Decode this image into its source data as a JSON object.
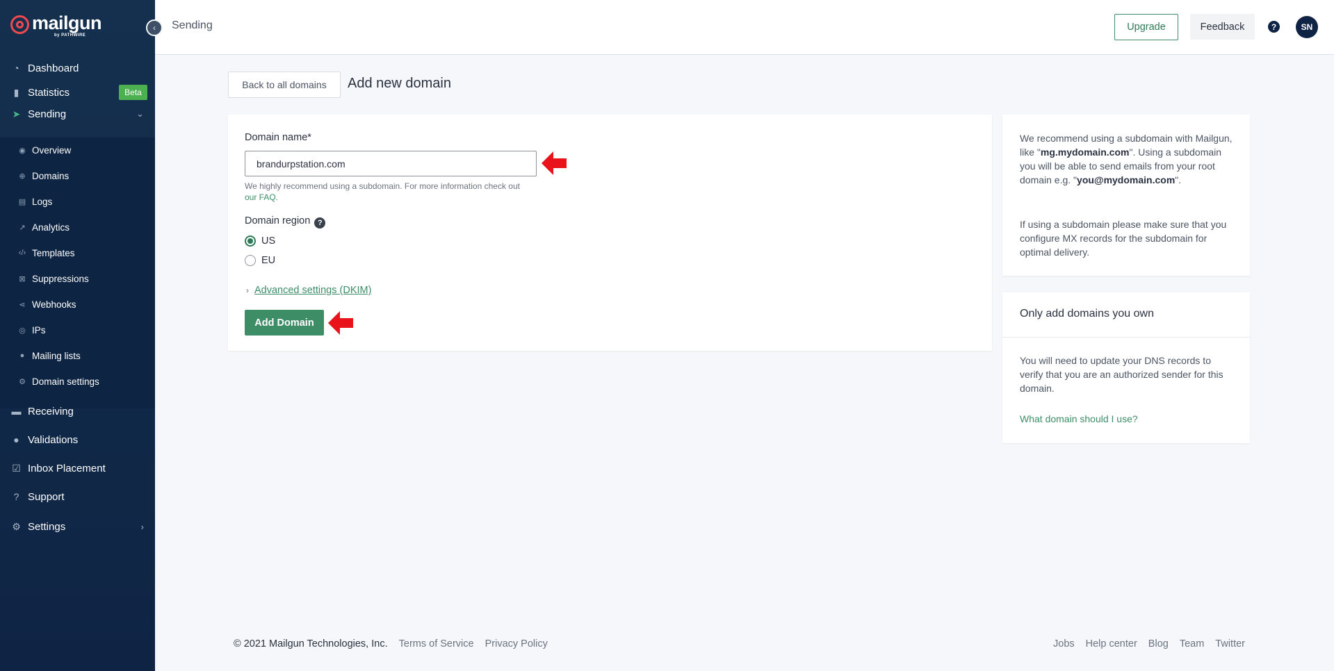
{
  "brand": {
    "name": "mailgun",
    "byline": "by PATHWIRE"
  },
  "topbar": {
    "section": "Sending",
    "upgrade": "Upgrade",
    "feedback": "Feedback",
    "help": "?",
    "avatar": "SN"
  },
  "nav": {
    "dashboard": "Dashboard",
    "statistics": "Statistics",
    "beta": "Beta",
    "sending": "Sending",
    "sub": {
      "overview": "Overview",
      "domains": "Domains",
      "logs": "Logs",
      "analytics": "Analytics",
      "templates": "Templates",
      "suppressions": "Suppressions",
      "webhooks": "Webhooks",
      "ips": "IPs",
      "mailing_lists": "Mailing lists",
      "domain_settings": "Domain settings"
    },
    "receiving": "Receiving",
    "validations": "Validations",
    "inbox_placement": "Inbox Placement",
    "support": "Support",
    "settings": "Settings"
  },
  "page": {
    "back": "Back to all domains",
    "title": "Add new domain"
  },
  "form": {
    "domain_label": "Domain name*",
    "domain_value": "brandurpstation.com",
    "hint_text": "We highly recommend using a subdomain. For more information check out",
    "hint_link": "our FAQ.",
    "region_label": "Domain region",
    "region_help": "?",
    "region_us": "US",
    "region_eu": "EU",
    "advanced": "Advanced settings (DKIM)",
    "submit": "Add Domain"
  },
  "info1": {
    "p1_a": "We recommend using a subdomain with Mailgun, like \"",
    "p1_b": "mg.mydomain.com",
    "p1_c": "\". Using a subdomain you will be able to send emails from your root domain e.g. \"",
    "p1_d": "you@mydomain.com",
    "p1_e": "\".",
    "p2": "If using a subdomain please make sure that you configure MX records for the subdomain for optimal delivery."
  },
  "info2": {
    "title": "Only add domains you own",
    "text": "You will need to update your DNS records to verify that you are an authorized sender for this domain.",
    "link": "What domain should I use?"
  },
  "footer": {
    "copyright": "© 2021 Mailgun Technologies, Inc.",
    "terms": "Terms of Service",
    "privacy": "Privacy Policy",
    "jobs": "Jobs",
    "help": "Help center",
    "blog": "Blog",
    "team": "Team",
    "twitter": "Twitter"
  },
  "colors": {
    "sidebar": "#112a48",
    "accent": "#3d8d67",
    "beta": "#4caf50",
    "arrow": "#e8131b"
  }
}
